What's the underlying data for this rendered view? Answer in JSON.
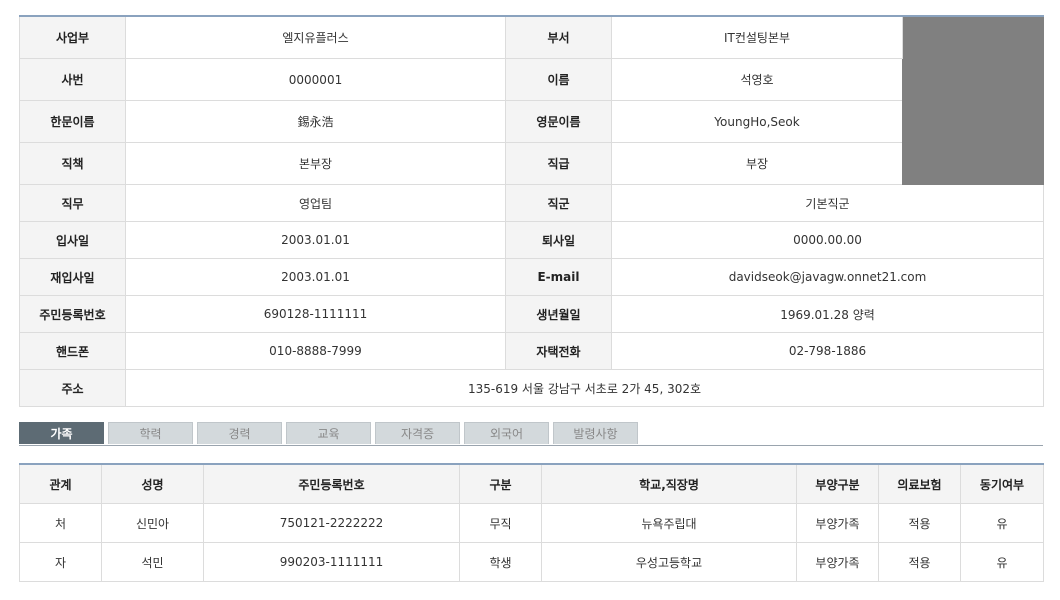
{
  "profile": {
    "labels": {
      "business": "사업부",
      "department": "부서",
      "emp_no": "사번",
      "name": "이름",
      "hanja_name": "한문이름",
      "english_name": "영문이름",
      "position": "직책",
      "rank": "직급",
      "duty": "직무",
      "rank_group": "직군",
      "join_date": "입사일",
      "leave_date": "퇴사일",
      "rejoin_date": "재입사일",
      "email": "E-mail",
      "resident_no": "주민등록번호",
      "birth_date": "생년월일",
      "mobile": "핸드폰",
      "home_phone": "자택전화",
      "address": "주소"
    },
    "values": {
      "business": "엘지유플러스",
      "department": "IT컨설팅본부",
      "emp_no": "0000001",
      "name": "석영호",
      "hanja_name": "錫永浩",
      "english_name": "YoungHo,Seok",
      "position": "본부장",
      "rank": "부장",
      "duty": "영업팀",
      "rank_group": "기본직군",
      "join_date": "2003.01.01",
      "leave_date": "0000.00.00",
      "rejoin_date": "2003.01.01",
      "email": "davidseok@javagw.onnet21.com",
      "resident_no": "690128-1111111",
      "birth_date": "1969.01.28 양력",
      "mobile": "010-8888-7999",
      "home_phone": "02-798-1886",
      "address": "135-619 서울 강남구 서초로 2가 45, 302호"
    }
  },
  "tabs": [
    "가족",
    "학력",
    "경력",
    "교육",
    "자격증",
    "외국어",
    "발령사항"
  ],
  "family": {
    "headers": [
      "관계",
      "성명",
      "주민등록번호",
      "구분",
      "학교,직장명",
      "부양구분",
      "의료보험",
      "동기여부"
    ],
    "rows": [
      [
        "처",
        "신민아",
        "750121-2222222",
        "무직",
        "뉴욕주립대",
        "부양가족",
        "적용",
        "유"
      ],
      [
        "자",
        "석민",
        "990203-1111111",
        "학생",
        "우성고등학교",
        "부양가족",
        "적용",
        "유"
      ]
    ]
  }
}
